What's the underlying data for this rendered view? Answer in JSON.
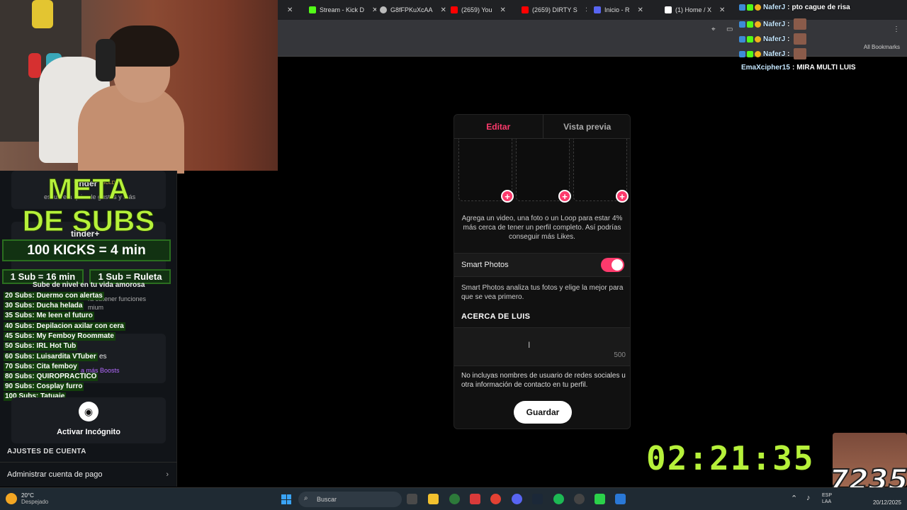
{
  "browser": {
    "tabs": [
      {
        "label": "",
        "color": "#888888"
      },
      {
        "label": "Stream - Kick D",
        "color": "#53fc18"
      },
      {
        "label": "G8fFPKuXcAA",
        "color": "#bbbbbb"
      },
      {
        "label": "(2659) You",
        "color": "#ff0000"
      },
      {
        "label": "(2659) DIRTY S",
        "color": "#ff0000"
      },
      {
        "label": "Inicio - R",
        "color": "#5865f2"
      },
      {
        "label": "(1) Home / X",
        "color": "#ffffff"
      }
    ],
    "bookmarks_label": "All Bookmarks"
  },
  "sidebar": {
    "meta_line1": "META",
    "meta_line2": "DE SUBS",
    "kicks_goal": "100 KICKS = 4 min",
    "sub_time": "1 Sub = 16 min",
    "sub_ruleta": "1 Sub = Ruleta",
    "goals": [
      "20 Subs: Duermo con alertas",
      "30 Subs: Ducha helada",
      "35 Subs: Me leen el futuro",
      "40 Subs: Depilacion axilar con cera",
      "45 Subs: My Femboy Roommate",
      "50 Subs: IRL Hot Tub",
      "60 Subs: Luisardita VTuber",
      "70 Subs: Cita femboy",
      "80 Subs: QUIROPRACTICO",
      "90 Subs: Cosplay furro",
      "100 Subs: Tatuaje"
    ],
    "ghost_tinder1": "tinder",
    "ghost_gold": "GOLD",
    "ghost_desc": "escubre a quien le gustas y más",
    "ghost_tinder2": "tinder+",
    "ghost_levelup": "Sube de nivel en tu vida amorosa",
    "ghost_feat": "ra obtener funciones",
    "ghost_premium": "mium",
    "ghost_es": "es",
    "ghost_boosts": "a más Boosts",
    "incognito_label": "Activar Incógnito",
    "account_heading": "AJUSTES DE CUENTA",
    "payment_label": "Administrar cuenta de pago"
  },
  "modal": {
    "tab_edit": "Editar",
    "tab_preview": "Vista previa",
    "photo_help": "Agrega un video, una foto o un Loop para estar 4% más cerca de tener un perfil completo. Así podrías conseguir más Likes.",
    "smart_photos_label": "Smart Photos",
    "smart_photos_on": true,
    "smart_help": "Smart Photos analiza tus fotos y elige la mejor para que se vea primero.",
    "about_title": "ACERCA DE LUIS",
    "about_value": "",
    "about_count": "500",
    "about_help": "No incluyas nombres de usuario de redes sociales u otra información de contacto en tu perfil.",
    "save_label": "Guardar",
    "accent": "#fd3a6c"
  },
  "chat": [
    {
      "user": "NaferJ",
      "sep": " : ",
      "msg": "pto cague de risa"
    },
    {
      "user": "NaferJ",
      "sep": " : ",
      "msg": ""
    },
    {
      "user": "NaferJ",
      "sep": " : ",
      "msg": ""
    },
    {
      "user": "NaferJ",
      "sep": " : ",
      "msg": ""
    },
    {
      "user": "EmaXcipher15",
      "sep": " : ",
      "msg": "MIRA MULTI LUIS"
    }
  ],
  "timer": "02:21:35",
  "overlay_number": "7235",
  "taskbar": {
    "temp": "20°C",
    "weather": "Despejado",
    "search_placeholder": "Buscar",
    "lang1": "ESP",
    "lang2": "LAA",
    "date": "20/12/2025"
  }
}
